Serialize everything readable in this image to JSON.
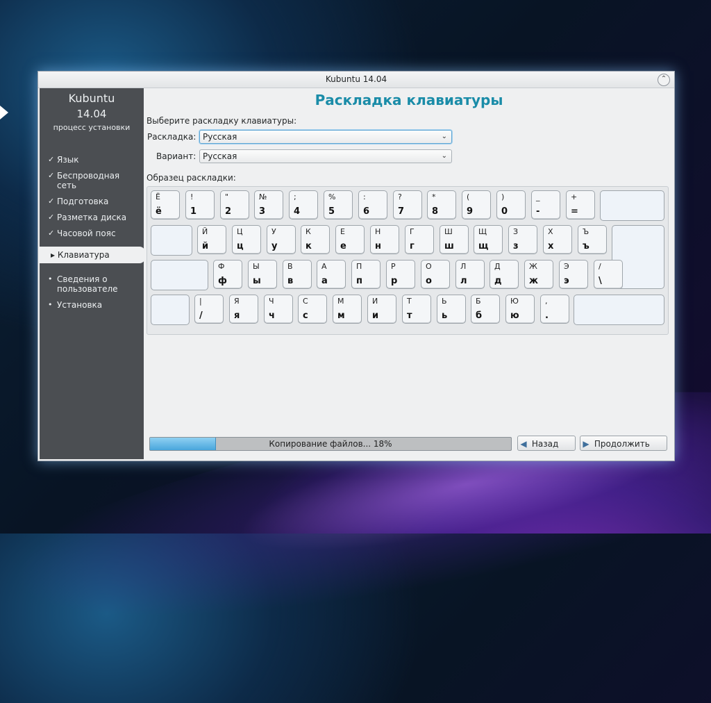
{
  "window": {
    "title": "Kubuntu 14.04",
    "close_glyph": "⌃"
  },
  "sidebar": {
    "brand_name": "Kubuntu",
    "brand_version": "14.04",
    "brand_sub": "процесс установки",
    "done_steps": [
      "Язык",
      "Беспроводная сеть",
      "Подготовка",
      "Разметка диска",
      "Часовой пояс"
    ],
    "active_step": "Клавиатура",
    "todo_steps": [
      "Сведения о пользователе",
      "Установка"
    ]
  },
  "page": {
    "title": "Раскладка клавиатуры",
    "prompt": "Выберите раскладку клавиатуры:",
    "layout_label": "Раскладка:",
    "layout_value": "Русская",
    "variant_label": "Вариант:",
    "variant_value": "Русская",
    "preview_label": "Образец раскладки:"
  },
  "keyboard": {
    "rows": [
      [
        [
          "Ё",
          "ё"
        ],
        [
          "!",
          "1"
        ],
        [
          "\"",
          "2"
        ],
        [
          "№",
          "3"
        ],
        [
          ";",
          "4"
        ],
        [
          "%",
          "5"
        ],
        [
          ":",
          "6"
        ],
        [
          "?",
          "7"
        ],
        [
          "*",
          "8"
        ],
        [
          "(",
          "9"
        ],
        [
          ")",
          "0"
        ],
        [
          "_",
          "-"
        ],
        [
          "+",
          "="
        ]
      ],
      [
        [
          "Й",
          "й"
        ],
        [
          "Ц",
          "ц"
        ],
        [
          "У",
          "у"
        ],
        [
          "К",
          "к"
        ],
        [
          "Е",
          "е"
        ],
        [
          "Н",
          "н"
        ],
        [
          "Г",
          "г"
        ],
        [
          "Ш",
          "ш"
        ],
        [
          "Щ",
          "щ"
        ],
        [
          "З",
          "з"
        ],
        [
          "Х",
          "х"
        ],
        [
          "Ъ",
          "ъ"
        ]
      ],
      [
        [
          "Ф",
          "ф"
        ],
        [
          "Ы",
          "ы"
        ],
        [
          "В",
          "в"
        ],
        [
          "А",
          "а"
        ],
        [
          "П",
          "п"
        ],
        [
          "Р",
          "р"
        ],
        [
          "О",
          "о"
        ],
        [
          "Л",
          "л"
        ],
        [
          "Д",
          "д"
        ],
        [
          "Ж",
          "ж"
        ],
        [
          "Э",
          "э"
        ],
        [
          "/",
          "\\"
        ]
      ],
      [
        [
          "|",
          "/"
        ],
        [
          "Я",
          "я"
        ],
        [
          "Ч",
          "ч"
        ],
        [
          "С",
          "с"
        ],
        [
          "М",
          "м"
        ],
        [
          "И",
          "и"
        ],
        [
          "Т",
          "т"
        ],
        [
          "Ь",
          "ь"
        ],
        [
          "Б",
          "б"
        ],
        [
          "Ю",
          "ю"
        ],
        [
          ",",
          "."
        ]
      ]
    ]
  },
  "footer": {
    "progress_text": "Копирование файлов... 18%",
    "progress_fraction": 0.18,
    "back_label": "Назад",
    "next_label": "Продолжить"
  }
}
